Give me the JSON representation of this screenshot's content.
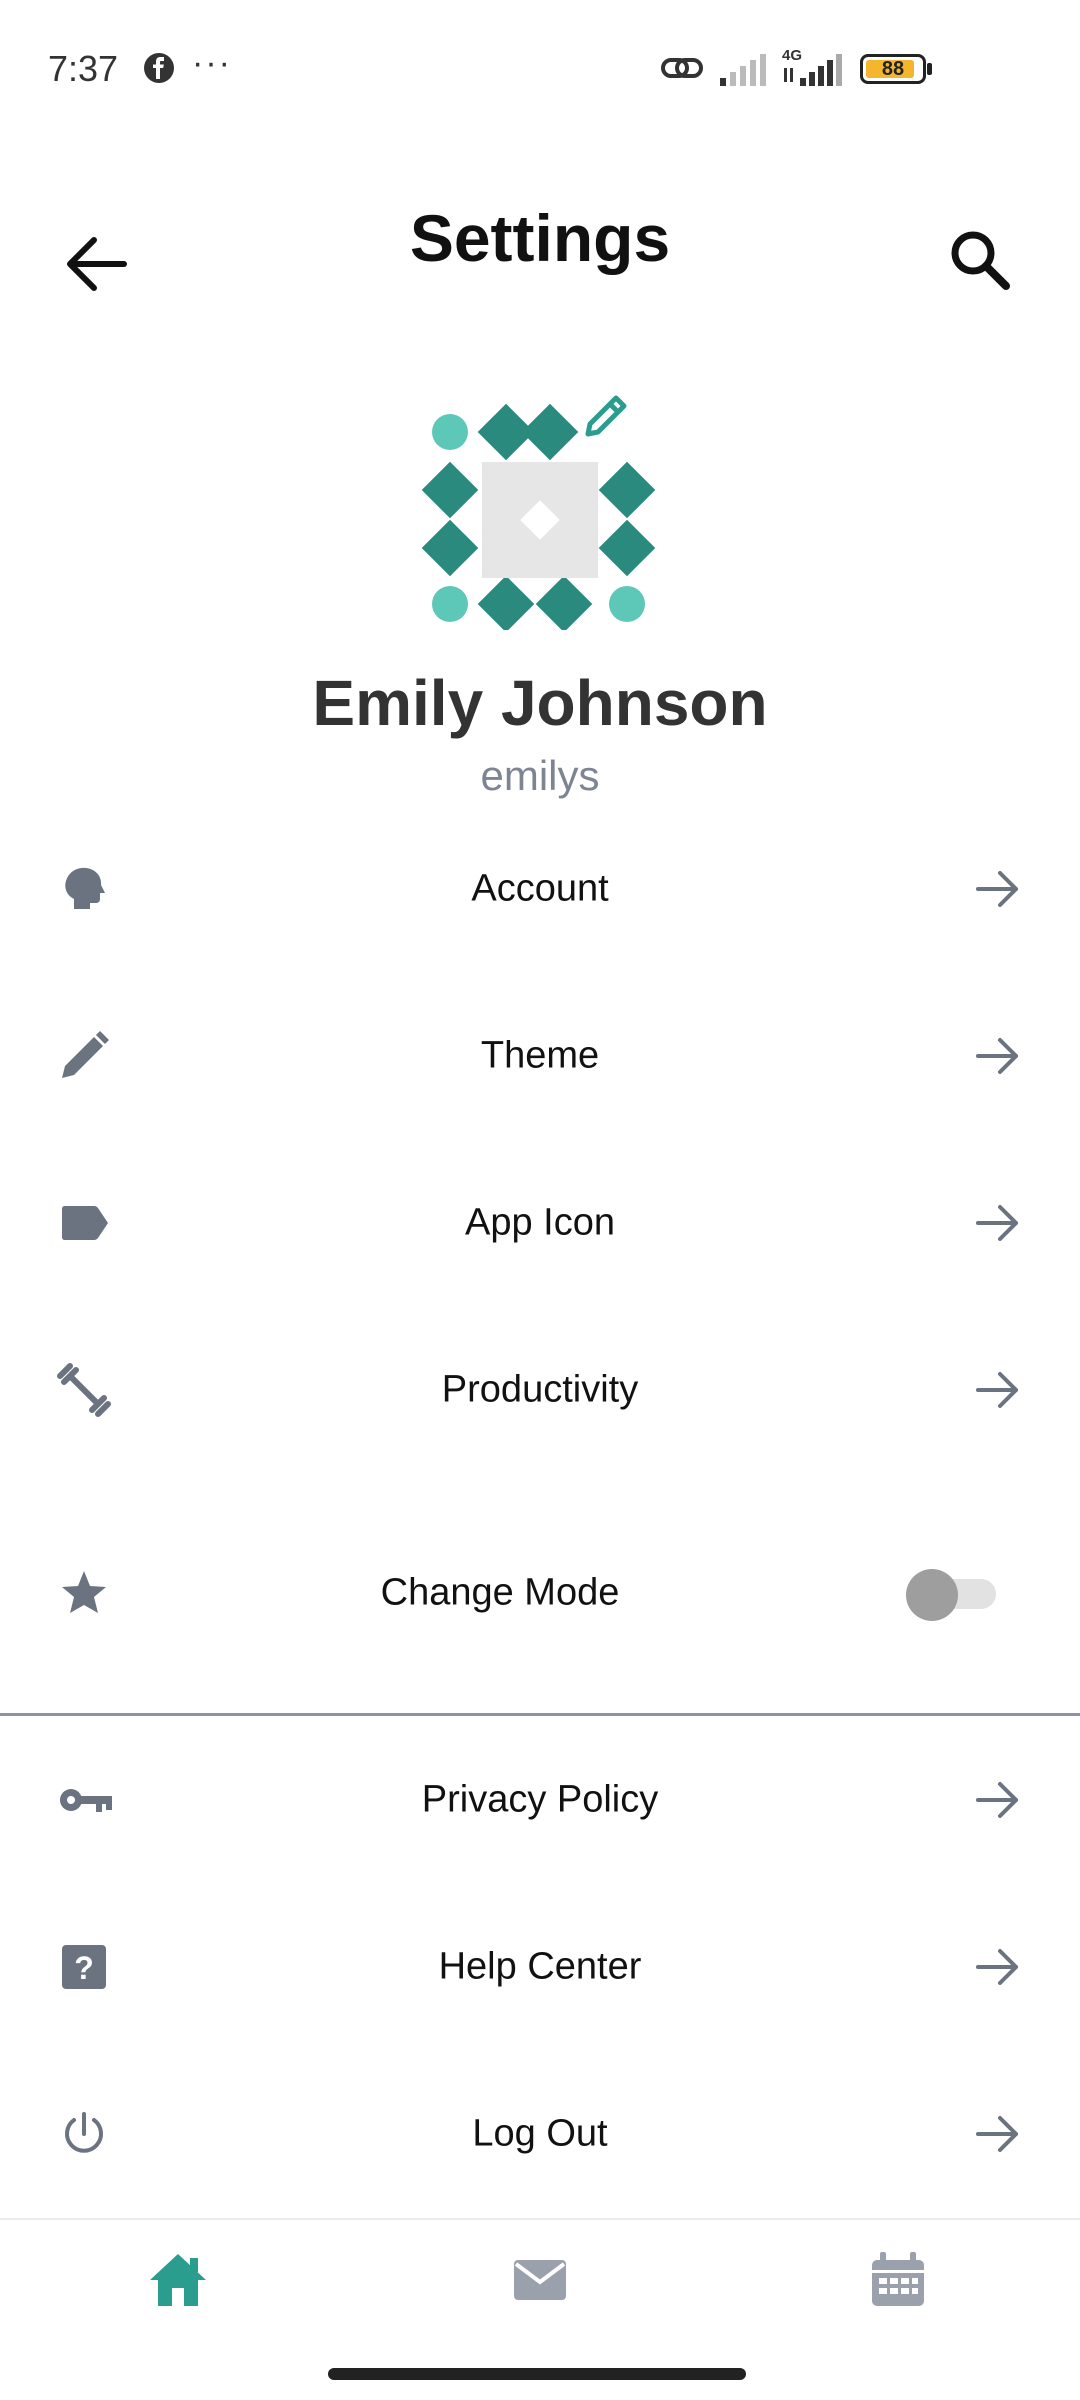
{
  "status_bar": {
    "time": "7:37",
    "battery": "88",
    "battery_level": 0.88,
    "network": "4G",
    "icons": [
      "facebook-icon",
      "more-dots-icon",
      "link-icon",
      "signal-icon",
      "signal-4g-icon",
      "battery-icon"
    ]
  },
  "header": {
    "title": "Settings",
    "back_icon": "arrow-left-icon",
    "search_icon": "search-icon"
  },
  "profile": {
    "name": "Emily Johnson",
    "username": "emilys",
    "avatar_icon": "geometric-avatar",
    "edit_icon": "pencil-icon"
  },
  "menu": {
    "account": "Account",
    "theme": "Theme",
    "app_icon": "App Icon",
    "productivity": "Productivity",
    "change_mode": "Change Mode",
    "change_mode_enabled": false,
    "privacy_policy": "Privacy Policy",
    "help_center": "Help Center",
    "log_out": "Log Out"
  },
  "bottom_nav": {
    "items": [
      "home",
      "mail",
      "calendar"
    ],
    "active": "home"
  },
  "colors": {
    "accent": "#2a9d8f",
    "accent_dark": "#2b8a7e",
    "accent_light": "#5ec8b8",
    "icon_gray": "#6b7280",
    "handle_gray": "#7d8593"
  }
}
